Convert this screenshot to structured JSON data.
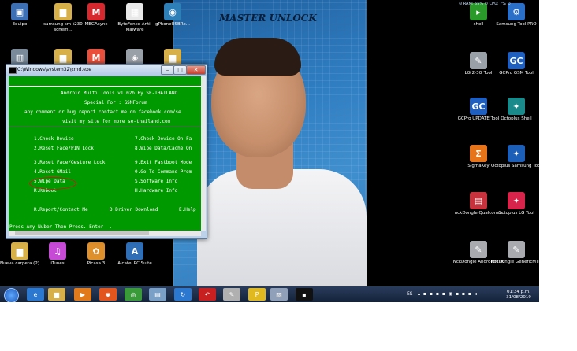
{
  "wallpaper": {
    "title": "MASTER UNLOCK"
  },
  "desktop_icons_left": [
    {
      "label": "Equipo",
      "icon": "computer-icon",
      "color": "#3c6fb4",
      "glyph": "▣"
    },
    {
      "label": "samsung sm-t230 schem...",
      "icon": "folder-icon",
      "color": "#d8b04a",
      "glyph": "▆"
    },
    {
      "label": "MEGAsync",
      "icon": "mega-icon",
      "color": "#d9272e",
      "glyph": "M"
    },
    {
      "label": "ByteFence Anti-Malware",
      "icon": "bytefence-icon",
      "color": "#e8e8e8",
      "glyph": "▦"
    },
    {
      "label": "gPhoneUSBRe...",
      "icon": "gphone-icon",
      "color": "#2e7fb8",
      "glyph": "◉"
    }
  ],
  "desktop_icons_left_row2": [
    {
      "label": "",
      "icon": "recycle-bin-icon",
      "color": "#7a8a9a",
      "glyph": "▥"
    },
    {
      "label": "",
      "icon": "folder-icon",
      "color": "#d8b04a",
      "glyph": "▆"
    },
    {
      "label": "",
      "icon": "app-icon",
      "color": "#e94f3a",
      "glyph": "M"
    },
    {
      "label": "",
      "icon": "gamepad-icon",
      "color": "#9aa0a8",
      "glyph": "◈"
    },
    {
      "label": "",
      "icon": "app-icon",
      "color": "#d8b04a",
      "glyph": "▆"
    }
  ],
  "desktop_icons_bottom": [
    {
      "label": "Nueva carpeta (2)",
      "icon": "folder-icon",
      "color": "#d8b04a",
      "glyph": "▆"
    },
    {
      "label": "iTunes",
      "icon": "itunes-icon",
      "color": "#c64ad6",
      "glyph": "♫"
    },
    {
      "label": "Picasa 3",
      "icon": "picasa-icon",
      "color": "#e0902a",
      "glyph": "✿"
    },
    {
      "label": "Alcatel PC Suite",
      "icon": "alcatel-icon",
      "color": "#2e6fb8",
      "glyph": "A"
    }
  ],
  "desktop_icons_right": [
    {
      "label": "shell",
      "icon": "shell-icon",
      "color": "#2a9a2a",
      "glyph": "▸"
    },
    {
      "label": "Samsung Tool PRO",
      "icon": "samsung-tool-icon",
      "color": "#2a6fc8",
      "glyph": "⚙"
    },
    {
      "label": "LG 2-3G Tool",
      "icon": "lg-tool-icon",
      "color": "#9aa0a8",
      "glyph": "✎"
    },
    {
      "label": "GCPro GSM Tool",
      "icon": "gcpro-icon",
      "color": "#1f5fc0",
      "glyph": "GC"
    },
    {
      "label": "GCPro UPDATE Tool",
      "icon": "gcpro-update-icon",
      "color": "#1f5fc0",
      "glyph": "GC"
    },
    {
      "label": "Octoplus Shell",
      "icon": "octoplus-shell-icon",
      "color": "#1b8a8a",
      "glyph": "✦"
    },
    {
      "label": "SigmaKey",
      "icon": "sigmakey-icon",
      "color": "#e8741a",
      "glyph": "Σ"
    },
    {
      "label": "Octoplus Samsung Tool",
      "icon": "octoplus-samsung-icon",
      "color": "#1b5fb8",
      "glyph": "✦"
    },
    {
      "label": "nckDongle Qualcomm",
      "icon": "nck-qualcomm-icon",
      "color": "#c8323c",
      "glyph": "▤"
    },
    {
      "label": "Octoplus LG Tool",
      "icon": "octoplus-lg-icon",
      "color": "#d8244a",
      "glyph": "✦"
    },
    {
      "label": "NckDongle AndroidMTK",
      "icon": "nck-android-icon",
      "color": "#a8aab0",
      "glyph": "✎"
    },
    {
      "label": "nckDongle GenericMTK",
      "icon": "nck-generic-icon",
      "color": "#a8aab0",
      "glyph": "✎"
    }
  ],
  "gadget": {
    "ram": "RAM: 65%",
    "cpu": "CPU: 7%"
  },
  "cmd": {
    "title": "C:\\Windows\\system32\\cmd.exe",
    "buttons": {
      "minimize": "–",
      "maximize": "□",
      "close": "✕"
    },
    "header": [
      "Android Multi Tools v1.02b By SE-THAILAND",
      "Special For : GSMForum",
      "any comment or bug report contact me on facebook.com/se",
      "visit my site for more se-thailand.com"
    ],
    "menu_left": [
      "1.Check Device",
      "2.Reset Face/PIN Lock",
      "3.Reset Face/Gesture Lock",
      "4.Reset GMail",
      "5.Wipe Data",
      "R.Reboot"
    ],
    "menu_right": [
      "7.Check Device On Fa",
      "8.Wipe Data/Cache On",
      "9.Exit Fastboot Mode",
      "0.Go To Command Prom",
      "S.Software Info",
      "H.Hardware Info"
    ],
    "footer_items": [
      "R.Report/Contact Me",
      "D.Driver Download",
      "E.Help"
    ],
    "prompt": "Press Any Nuber Then Press. Enter  ."
  },
  "taskbar": {
    "items": [
      {
        "icon": "ie-icon",
        "color": "#2a78d0",
        "glyph": "e"
      },
      {
        "icon": "explorer-icon",
        "color": "#d8b04a",
        "glyph": "▆"
      },
      {
        "icon": "media-player-icon",
        "color": "#e07a1a",
        "glyph": "▶"
      },
      {
        "icon": "firefox-icon",
        "color": "#e2561e",
        "glyph": "◉"
      },
      {
        "icon": "chrome-icon",
        "color": "#3a9a3a",
        "glyph": "◎"
      },
      {
        "icon": "notepad-icon",
        "color": "#7aa0c8",
        "glyph": "▤"
      },
      {
        "icon": "refresh-app-icon",
        "color": "#2a78d0",
        "glyph": "↻"
      },
      {
        "icon": "lg-app-icon",
        "color": "#c82020",
        "glyph": "↶"
      },
      {
        "icon": "paint-icon",
        "color": "#b0b0b0",
        "glyph": "✎"
      },
      {
        "icon": "pikav-icon",
        "color": "#e0b820",
        "glyph": "P"
      },
      {
        "icon": "docs-icon",
        "color": "#90a0b8",
        "glyph": "▧"
      },
      {
        "icon": "cmd-taskbar-icon",
        "color": "#111111",
        "glyph": "▪"
      }
    ],
    "language": "ES",
    "tray_icons": "▴ ▪ ▪ ▪ ▪ ◉ ▪ ▪ ▪ ◂",
    "time": "01:34 p.m.",
    "date": "31/08/2019"
  }
}
